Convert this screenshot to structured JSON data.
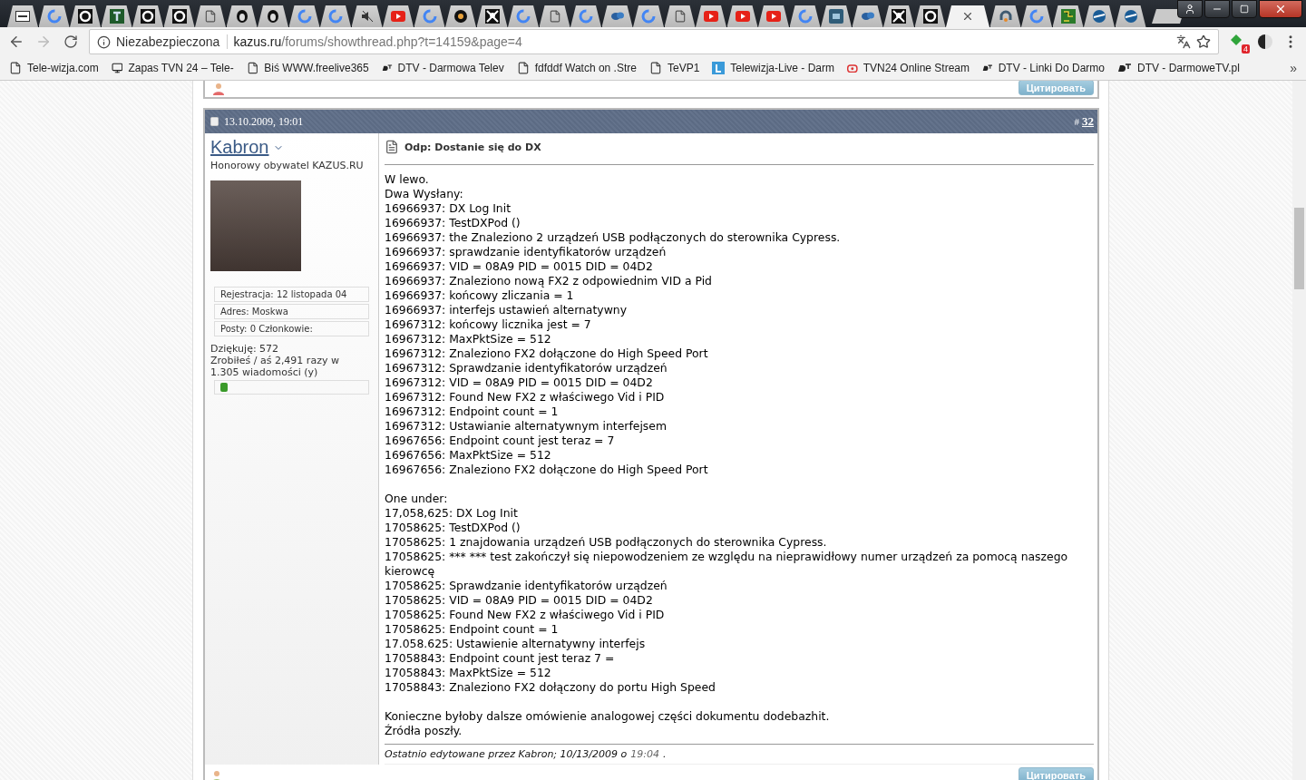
{
  "browser": {
    "tabs": [
      {
        "kind": "se",
        "selected": false
      },
      {
        "kind": "google",
        "selected": false
      },
      {
        "kind": "e",
        "selected": false
      },
      {
        "kind": "t",
        "selected": false
      },
      {
        "kind": "e",
        "selected": false
      },
      {
        "kind": "e",
        "selected": false
      },
      {
        "kind": "page",
        "selected": false
      },
      {
        "kind": "skull",
        "selected": false
      },
      {
        "kind": "skull",
        "selected": false
      },
      {
        "kind": "google",
        "selected": false
      },
      {
        "kind": "google",
        "selected": false
      },
      {
        "kind": "mute",
        "selected": false
      },
      {
        "kind": "youtube",
        "selected": false
      },
      {
        "kind": "google",
        "selected": false
      },
      {
        "kind": "diy",
        "selected": false
      },
      {
        "kind": "pirate",
        "selected": false
      },
      {
        "kind": "google",
        "selected": false
      },
      {
        "kind": "page",
        "selected": false
      },
      {
        "kind": "google",
        "selected": false
      },
      {
        "kind": "chat",
        "selected": false
      },
      {
        "kind": "google",
        "selected": false
      },
      {
        "kind": "page",
        "selected": false
      },
      {
        "kind": "youtube",
        "selected": false
      },
      {
        "kind": "youtube",
        "selected": false
      },
      {
        "kind": "youtube",
        "selected": false
      },
      {
        "kind": "google",
        "selected": false
      },
      {
        "kind": "sf",
        "selected": false
      },
      {
        "kind": "chat",
        "selected": false
      },
      {
        "kind": "pirate",
        "selected": false
      },
      {
        "kind": "e",
        "selected": false
      },
      {
        "selected": true
      },
      {
        "kind": "headset",
        "selected": false
      },
      {
        "kind": "google",
        "selected": false
      },
      {
        "kind": "circuit",
        "selected": false
      },
      {
        "kind": "plane",
        "selected": false
      },
      {
        "kind": "plane",
        "selected": false
      }
    ],
    "address": {
      "security": "Niezabezpieczona",
      "host": "kazus.ru",
      "path": "/forums/showthread.php?t=14159&page=4"
    },
    "extension_badge": "4",
    "bookmarks": [
      {
        "kind": "page",
        "label": "Tele-wizja.com"
      },
      {
        "kind": "monitor",
        "label": "Zapas TVN 24 – Tele-"
      },
      {
        "kind": "page",
        "label": "Biś WWW.freelive365"
      },
      {
        "kind": "dtv",
        "label": "DTV - Darmowa Telev"
      },
      {
        "kind": "page",
        "label": "fdfddf Watch on .Stre"
      },
      {
        "kind": "page",
        "label": "TeVP1"
      },
      {
        "kind": "letter",
        "label": "Telewizja-Live - Darm"
      },
      {
        "kind": "tv",
        "label": "TVN24 Online Stream"
      },
      {
        "kind": "dtv",
        "label": "DTV - Linki Do Darmo"
      },
      {
        "kind": "dtv",
        "label": "DTV - DarmoweTV.pl"
      }
    ],
    "bookmarks_more": "»"
  },
  "prev_post": {
    "quote_button": "Цитировать"
  },
  "post": {
    "date": "13.10.2009, 19:01",
    "number_prefix": "#",
    "number": "32",
    "user": {
      "name": "Kabron",
      "title": "Honorowy obywatel KAZUS.RU",
      "stats": [
        "Rejestracja: 12 listopada 04",
        "Adres: Moskwa",
        "Posty: 0 Członkowie:"
      ],
      "thanks": "Dziękuję: 572",
      "thanked": "Zrobiłeś / aś 2,491 razy w 1.305 wiadomości (y)"
    },
    "title": "Odp: Dostanie się do DX",
    "paragraphs": [
      [
        "W lewo.",
        "Dwa Wysłany:",
        "16966937: DX Log Init",
        "16966937: TestDXPod ()",
        "16966937: the Znaleziono 2 urządzeń USB podłączonych do sterownika Cypress.",
        "16966937: sprawdzanie identyfikatorów urządzeń",
        "16966937: VID = 08A9 PID = 0015 DID = 04D2",
        "16966937: Znaleziono nową FX2 z odpowiednim VID a Pid",
        "16966937: końcowy zliczania = 1",
        "16966937: interfejs ustawień alternatywny",
        "16967312: końcowy licznika jest = 7",
        "16967312: MaxPktSize = 512",
        "16967312: Znaleziono FX2 dołączone do High Speed Port",
        "16967312: Sprawdzanie identyfikatorów urządzeń",
        "16967312: VID = 08A9 PID = 0015 DID = 04D2",
        "16967312: Found New FX2 z właściwego Vid i PID",
        "16967312: Endpoint count = 1",
        "16967312: Ustawianie alternatywnym interfejsem",
        "16967656: Endpoint count jest teraz = 7",
        "16967656: MaxPktSize = 512",
        "16967656: Znaleziono FX2 dołączone do High Speed Port"
      ],
      [
        "One under:",
        "17,058,625: DX Log Init",
        "17058625: TestDXPod ()",
        "17058625: 1 znajdowania urządzeń USB podłączonych do sterownika Cypress.",
        "17058625: *** *** test zakończył się niepowodzeniem ze względu na nieprawidłowy numer urządzeń za pomocą naszego kierowcę",
        "17058625: Sprawdzanie identyfikatorów urządzeń",
        "17058625: VID = 08A9 PID = 0015 DID = 04D2",
        "17058625: Found New FX2 z właściwego Vid i PID",
        "17058625: Endpoint count = 1",
        "17.058.625: Ustawienie alternatywny interfejs",
        "17058843: Endpoint count jest teraz 7 =",
        "17058843: MaxPktSize = 512",
        "17058843: Znaleziono FX2 dołączony do portu High Speed"
      ],
      [
        "Konieczne byłoby dalsze omówienie analogowej części dokumentu dodebazhit.",
        "Źródła poszły."
      ]
    ],
    "edited": {
      "text": "Ostatnio edytowane przez Kabron; 10/13/2009 o",
      "time": "19:04",
      "end": "."
    },
    "quote_button": "Цитировать"
  }
}
